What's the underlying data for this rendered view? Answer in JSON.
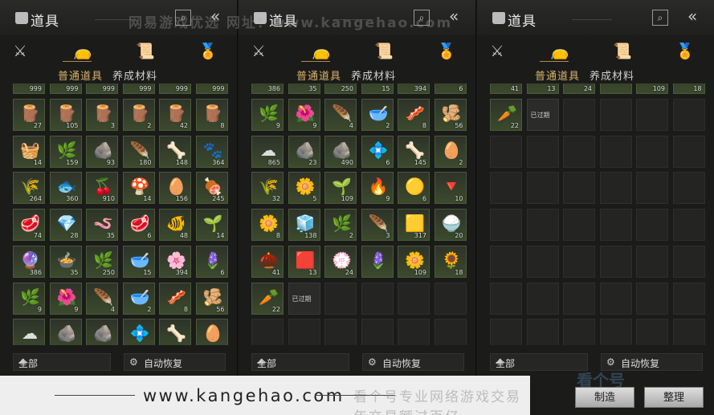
{
  "panels": [
    {
      "title": "道具",
      "sub_tabs": [
        "普通道具",
        "养成材料"
      ],
      "filter": "全部",
      "auto": "自动恢复",
      "top_partial": [
        "999",
        "999",
        "999",
        "999",
        "999",
        "999"
      ],
      "items": [
        {
          "icon": "wood-logs-icon",
          "glyph": "🪵",
          "count": "27",
          "bg": "green"
        },
        {
          "icon": "wood-logs-icon",
          "glyph": "🪵",
          "count": "105",
          "bg": "green"
        },
        {
          "icon": "wood-logs-icon",
          "glyph": "🪵",
          "count": "3",
          "bg": "green"
        },
        {
          "icon": "wood-logs-icon",
          "glyph": "🪵",
          "count": "2",
          "bg": "green"
        },
        {
          "icon": "wood-logs-icon",
          "glyph": "🪵",
          "count": "42",
          "bg": "green"
        },
        {
          "icon": "wood-logs-icon",
          "glyph": "🪵",
          "count": "8",
          "bg": "green"
        },
        {
          "icon": "firewood-bundle-icon",
          "glyph": "🧺",
          "count": "14",
          "bg": "green"
        },
        {
          "icon": "branches-icon",
          "glyph": "🌿",
          "count": "159",
          "bg": "green"
        },
        {
          "icon": "stone-icon",
          "glyph": "🪨",
          "count": "93",
          "bg": "green"
        },
        {
          "icon": "feather-icon",
          "glyph": "🪶",
          "count": "180",
          "bg": "green"
        },
        {
          "icon": "bones-icon",
          "glyph": "🦴",
          "count": "148",
          "bg": "green"
        },
        {
          "icon": "animal-hide-icon",
          "glyph": "🐾",
          "count": "364",
          "bg": "green"
        },
        {
          "icon": "grain-sack-icon",
          "glyph": "🌾",
          "count": "264",
          "bg": "green"
        },
        {
          "icon": "fish-icon",
          "glyph": "🐟",
          "count": "360",
          "bg": "green"
        },
        {
          "icon": "berries-icon",
          "glyph": "🍒",
          "count": "910",
          "bg": "green"
        },
        {
          "icon": "mushroom-icon",
          "glyph": "🍄",
          "count": "14",
          "bg": "green"
        },
        {
          "icon": "eggs-icon",
          "glyph": "🥚",
          "count": "156",
          "bg": "green"
        },
        {
          "icon": "meat-chunks-icon",
          "glyph": "🍖",
          "count": "245",
          "bg": "green"
        },
        {
          "icon": "raw-meat-icon",
          "glyph": "🥩",
          "count": "74",
          "bg": "green"
        },
        {
          "icon": "jade-stone-icon",
          "glyph": "💎",
          "count": "28",
          "bg": "green"
        },
        {
          "icon": "worm-icon",
          "glyph": "🪱",
          "count": "35",
          "bg": "green"
        },
        {
          "icon": "raw-meat-icon",
          "glyph": "🥩",
          "count": "6",
          "bg": "green"
        },
        {
          "icon": "golden-fish-icon",
          "glyph": "🐠",
          "count": "48",
          "bg": "green"
        },
        {
          "icon": "herb-bundle-icon",
          "glyph": "🌱",
          "count": "14",
          "bg": "green"
        },
        {
          "icon": "amethyst-icon",
          "glyph": "🔮",
          "count": "386",
          "bg": "green"
        },
        {
          "icon": "cooked-dish-icon",
          "glyph": "🍲",
          "count": "35",
          "bg": "green"
        },
        {
          "icon": "herb-plant-icon",
          "glyph": "🌿",
          "count": "250",
          "bg": "green"
        },
        {
          "icon": "seed-bowl-icon",
          "glyph": "🥣",
          "count": "15",
          "bg": "green"
        },
        {
          "icon": "purple-flower-icon",
          "glyph": "🌸",
          "count": "394",
          "bg": "green"
        },
        {
          "icon": "lavender-icon",
          "glyph": "🪻",
          "count": "6",
          "bg": "green"
        },
        {
          "icon": "twig-icon",
          "glyph": "🌿",
          "count": "9",
          "bg": "green"
        },
        {
          "icon": "red-flower-icon",
          "glyph": "🌺",
          "count": "9",
          "bg": "green"
        },
        {
          "icon": "white-feather-icon",
          "glyph": "🪶",
          "count": "4",
          "bg": "green"
        },
        {
          "icon": "wooden-bowl-icon",
          "glyph": "🥣",
          "count": "2",
          "bg": "green"
        },
        {
          "icon": "meat-slice-icon",
          "glyph": "🥓",
          "count": "8",
          "bg": "green"
        },
        {
          "icon": "ginseng-root-icon",
          "glyph": "🫚",
          "count": "56",
          "bg": "green"
        },
        {
          "icon": "cotton-icon",
          "glyph": "☁",
          "count": "",
          "bg": "green"
        },
        {
          "icon": "ore-icon",
          "glyph": "🪨",
          "count": "",
          "bg": "green"
        },
        {
          "icon": "ore-icon",
          "glyph": "🪨",
          "count": "",
          "bg": "green"
        },
        {
          "icon": "blue-crystal-icon",
          "glyph": "💠",
          "count": "",
          "bg": "green"
        },
        {
          "icon": "spine-bone-icon",
          "glyph": "🦴",
          "count": "",
          "bg": "green"
        },
        {
          "icon": "green-egg-icon",
          "glyph": "🥚",
          "count": "",
          "bg": "green"
        }
      ]
    },
    {
      "title": "道具",
      "sub_tabs": [
        "普通道具",
        "养成材料"
      ],
      "filter": "全部",
      "auto": "自动恢复",
      "top_partial": [
        "386",
        "35",
        "250",
        "15",
        "394",
        "6"
      ],
      "items": [
        {
          "icon": "twig-icon",
          "glyph": "🌿",
          "count": "9",
          "bg": "green"
        },
        {
          "icon": "red-flower-icon",
          "glyph": "🌺",
          "count": "9",
          "bg": "green"
        },
        {
          "icon": "white-feather-icon",
          "glyph": "🪶",
          "count": "4",
          "bg": "green"
        },
        {
          "icon": "wooden-bowl-icon",
          "glyph": "🥣",
          "count": "2",
          "bg": "green"
        },
        {
          "icon": "meat-slice-icon",
          "glyph": "🥓",
          "count": "8",
          "bg": "green"
        },
        {
          "icon": "ginseng-root-icon",
          "glyph": "🫚",
          "count": "56",
          "bg": "green"
        },
        {
          "icon": "cotton-icon",
          "glyph": "☁",
          "count": "865",
          "bg": "green"
        },
        {
          "icon": "ore-icon",
          "glyph": "🪨",
          "count": "23",
          "bg": "green"
        },
        {
          "icon": "ore-icon",
          "glyph": "🪨",
          "count": "490",
          "bg": "green"
        },
        {
          "icon": "blue-crystal-icon",
          "glyph": "💠",
          "count": "6",
          "bg": "green"
        },
        {
          "icon": "spine-bone-icon",
          "glyph": "🦴",
          "count": "145",
          "bg": "green"
        },
        {
          "icon": "green-egg-icon",
          "glyph": "🥚",
          "count": "2",
          "bg": "green"
        },
        {
          "icon": "grain-sack-icon",
          "glyph": "🌾",
          "count": "32",
          "bg": "green"
        },
        {
          "icon": "white-flower-icon",
          "glyph": "🌼",
          "count": "5",
          "bg": "green"
        },
        {
          "icon": "green-sprout-icon",
          "glyph": "🌱",
          "count": "109",
          "bg": "green"
        },
        {
          "icon": "torch-icon",
          "glyph": "🔥",
          "count": "9",
          "bg": "green"
        },
        {
          "icon": "gold-ore-icon",
          "glyph": "🟡",
          "count": "6",
          "bg": "green"
        },
        {
          "icon": "red-crystal-icon",
          "glyph": "🔻",
          "count": "10",
          "bg": "green"
        },
        {
          "icon": "white-flower-icon",
          "glyph": "🌼",
          "count": "8",
          "bg": "green"
        },
        {
          "icon": "jade-tablet-icon",
          "glyph": "🧊",
          "count": "138",
          "bg": "green"
        },
        {
          "icon": "black-plant-icon",
          "glyph": "🌿",
          "count": "2",
          "bg": "green"
        },
        {
          "icon": "black-feather-icon",
          "glyph": "🪶",
          "count": "3",
          "bg": "green"
        },
        {
          "icon": "gold-nugget-icon",
          "glyph": "🟨",
          "count": "317",
          "bg": "green"
        },
        {
          "icon": "rice-bowl-icon",
          "glyph": "🍚",
          "count": "20",
          "bg": "green"
        },
        {
          "icon": "nuts-icon",
          "glyph": "🌰",
          "count": "41",
          "bg": "green"
        },
        {
          "icon": "red-bar-icon",
          "glyph": "🟥",
          "count": "13",
          "bg": "green"
        },
        {
          "icon": "flower-cluster-icon",
          "glyph": "💮",
          "count": "24",
          "bg": "green"
        },
        {
          "icon": "purple-herb-icon",
          "glyph": "🪻",
          "count": "",
          "bg": "green"
        },
        {
          "icon": "dandelion-icon",
          "glyph": "🌼",
          "count": "109",
          "bg": "green"
        },
        {
          "icon": "golden-flower-icon",
          "glyph": "🌻",
          "count": "18",
          "bg": "green"
        },
        {
          "icon": "radish-icon",
          "glyph": "🥕",
          "count": "22",
          "bg": "green"
        },
        {
          "icon": "expired-item-icon",
          "glyph": "",
          "label": "已过期",
          "count": "",
          "bg": "gray"
        }
      ]
    },
    {
      "title": "道具",
      "sub_tabs": [
        "普通道具",
        "养成材料"
      ],
      "filter": "全部",
      "auto": "自动恢复",
      "top_partial": [
        "41",
        "13",
        "24",
        "",
        "109",
        "18"
      ],
      "items": [
        {
          "icon": "radish-icon",
          "glyph": "🥕",
          "count": "22",
          "bg": "green"
        },
        {
          "icon": "expired-item-icon",
          "glyph": "",
          "label": "已过期",
          "count": "",
          "bg": "gray"
        }
      ]
    }
  ],
  "buttons": {
    "craft": "制造",
    "sort": "整理"
  },
  "watermark": {
    "top": "网易游戏优选  网址：www.kangehao.com",
    "banner": "www.kangehao.com",
    "banner_sub": "看个号专业网络游戏交易  年交易额过百亿",
    "corner": "看个号"
  },
  "colors": {
    "accent": "#d9b36c",
    "slot_green": "#3b4a2c"
  }
}
